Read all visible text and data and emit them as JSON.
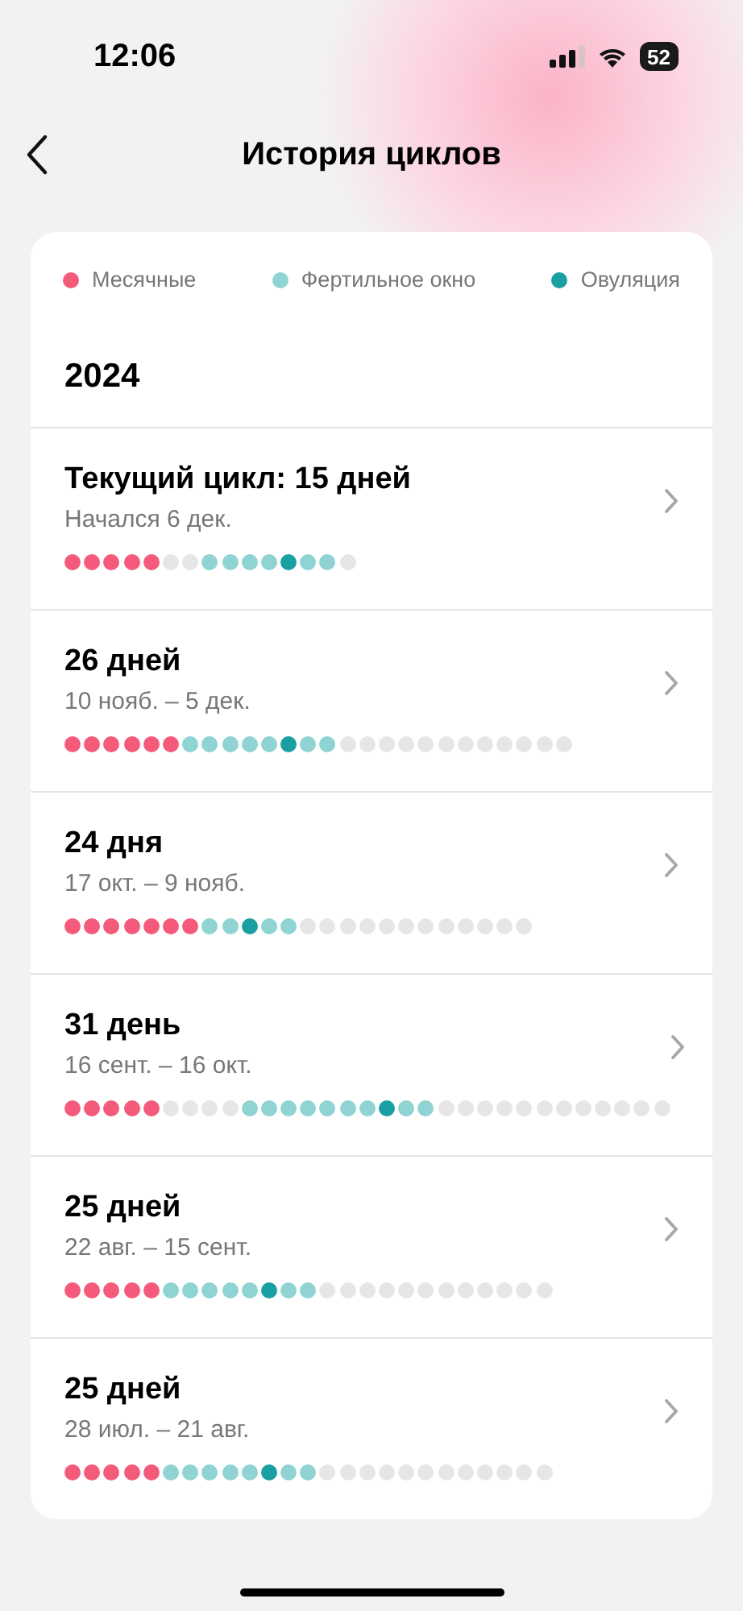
{
  "status_bar": {
    "time": "12:06",
    "battery": "52"
  },
  "header": {
    "title": "История циклов"
  },
  "legend": [
    {
      "label": "Месячные",
      "color": "#f45b7a"
    },
    {
      "label": "Фертильное окно",
      "color": "#8fd3d3"
    },
    {
      "label": "Овуляция",
      "color": "#1a9fa3"
    }
  ],
  "year": "2024",
  "cycles": [
    {
      "title": "Текущий цикл: 15 дней",
      "dates": "Начался 6 дек.",
      "days": [
        {
          "kind": "period"
        },
        {
          "kind": "period"
        },
        {
          "kind": "period"
        },
        {
          "kind": "period"
        },
        {
          "kind": "period"
        },
        {
          "kind": "none"
        },
        {
          "kind": "none"
        },
        {
          "kind": "fertile"
        },
        {
          "kind": "fertile"
        },
        {
          "kind": "fertile"
        },
        {
          "kind": "fertile"
        },
        {
          "kind": "ovulation"
        },
        {
          "kind": "fertile"
        },
        {
          "kind": "fertile"
        },
        {
          "kind": "none"
        }
      ]
    },
    {
      "title": "26 дней",
      "dates": "10 нояб. – 5 дек.",
      "days": [
        {
          "kind": "period"
        },
        {
          "kind": "period"
        },
        {
          "kind": "period"
        },
        {
          "kind": "period"
        },
        {
          "kind": "period"
        },
        {
          "kind": "period"
        },
        {
          "kind": "fertile"
        },
        {
          "kind": "fertile"
        },
        {
          "kind": "fertile"
        },
        {
          "kind": "fertile"
        },
        {
          "kind": "fertile"
        },
        {
          "kind": "ovulation"
        },
        {
          "kind": "fertile"
        },
        {
          "kind": "fertile"
        },
        {
          "kind": "none"
        },
        {
          "kind": "none"
        },
        {
          "kind": "none"
        },
        {
          "kind": "none"
        },
        {
          "kind": "none"
        },
        {
          "kind": "none"
        },
        {
          "kind": "none"
        },
        {
          "kind": "none"
        },
        {
          "kind": "none"
        },
        {
          "kind": "none"
        },
        {
          "kind": "none"
        },
        {
          "kind": "none"
        }
      ]
    },
    {
      "title": "24 дня",
      "dates": "17 окт. – 9 нояб.",
      "days": [
        {
          "kind": "period"
        },
        {
          "kind": "period"
        },
        {
          "kind": "period"
        },
        {
          "kind": "period"
        },
        {
          "kind": "period"
        },
        {
          "kind": "period"
        },
        {
          "kind": "period"
        },
        {
          "kind": "fertile"
        },
        {
          "kind": "fertile"
        },
        {
          "kind": "ovulation"
        },
        {
          "kind": "fertile"
        },
        {
          "kind": "fertile"
        },
        {
          "kind": "none"
        },
        {
          "kind": "none"
        },
        {
          "kind": "none"
        },
        {
          "kind": "none"
        },
        {
          "kind": "none"
        },
        {
          "kind": "none"
        },
        {
          "kind": "none"
        },
        {
          "kind": "none"
        },
        {
          "kind": "none"
        },
        {
          "kind": "none"
        },
        {
          "kind": "none"
        },
        {
          "kind": "none"
        }
      ]
    },
    {
      "title": "31 день",
      "dates": "16 сент. – 16 окт.",
      "days": [
        {
          "kind": "period"
        },
        {
          "kind": "period"
        },
        {
          "kind": "period"
        },
        {
          "kind": "period"
        },
        {
          "kind": "period"
        },
        {
          "kind": "none"
        },
        {
          "kind": "none"
        },
        {
          "kind": "none"
        },
        {
          "kind": "none"
        },
        {
          "kind": "fertile"
        },
        {
          "kind": "fertile"
        },
        {
          "kind": "fertile"
        },
        {
          "kind": "fertile"
        },
        {
          "kind": "fertile"
        },
        {
          "kind": "fertile"
        },
        {
          "kind": "fertile"
        },
        {
          "kind": "ovulation"
        },
        {
          "kind": "fertile"
        },
        {
          "kind": "fertile"
        },
        {
          "kind": "none"
        },
        {
          "kind": "none"
        },
        {
          "kind": "none"
        },
        {
          "kind": "none"
        },
        {
          "kind": "none"
        },
        {
          "kind": "none"
        },
        {
          "kind": "none"
        },
        {
          "kind": "none"
        },
        {
          "kind": "none"
        },
        {
          "kind": "none"
        },
        {
          "kind": "none"
        },
        {
          "kind": "none"
        }
      ]
    },
    {
      "title": "25 дней",
      "dates": "22 авг. – 15 сент.",
      "days": [
        {
          "kind": "period"
        },
        {
          "kind": "period"
        },
        {
          "kind": "period"
        },
        {
          "kind": "period"
        },
        {
          "kind": "period"
        },
        {
          "kind": "fertile"
        },
        {
          "kind": "fertile"
        },
        {
          "kind": "fertile"
        },
        {
          "kind": "fertile"
        },
        {
          "kind": "fertile"
        },
        {
          "kind": "ovulation"
        },
        {
          "kind": "fertile"
        },
        {
          "kind": "fertile"
        },
        {
          "kind": "none"
        },
        {
          "kind": "none"
        },
        {
          "kind": "none"
        },
        {
          "kind": "none"
        },
        {
          "kind": "none"
        },
        {
          "kind": "none"
        },
        {
          "kind": "none"
        },
        {
          "kind": "none"
        },
        {
          "kind": "none"
        },
        {
          "kind": "none"
        },
        {
          "kind": "none"
        },
        {
          "kind": "none"
        }
      ]
    },
    {
      "title": "25 дней",
      "dates": "28 июл. – 21 авг.",
      "days": [
        {
          "kind": "period"
        },
        {
          "kind": "period"
        },
        {
          "kind": "period"
        },
        {
          "kind": "period"
        },
        {
          "kind": "period"
        },
        {
          "kind": "fertile"
        },
        {
          "kind": "fertile"
        },
        {
          "kind": "fertile"
        },
        {
          "kind": "fertile"
        },
        {
          "kind": "fertile"
        },
        {
          "kind": "ovulation"
        },
        {
          "kind": "fertile"
        },
        {
          "kind": "fertile"
        },
        {
          "kind": "none"
        },
        {
          "kind": "none"
        },
        {
          "kind": "none"
        },
        {
          "kind": "none"
        },
        {
          "kind": "none"
        },
        {
          "kind": "none"
        },
        {
          "kind": "none"
        },
        {
          "kind": "none"
        },
        {
          "kind": "none"
        },
        {
          "kind": "none"
        },
        {
          "kind": "none"
        },
        {
          "kind": "none"
        }
      ]
    }
  ]
}
